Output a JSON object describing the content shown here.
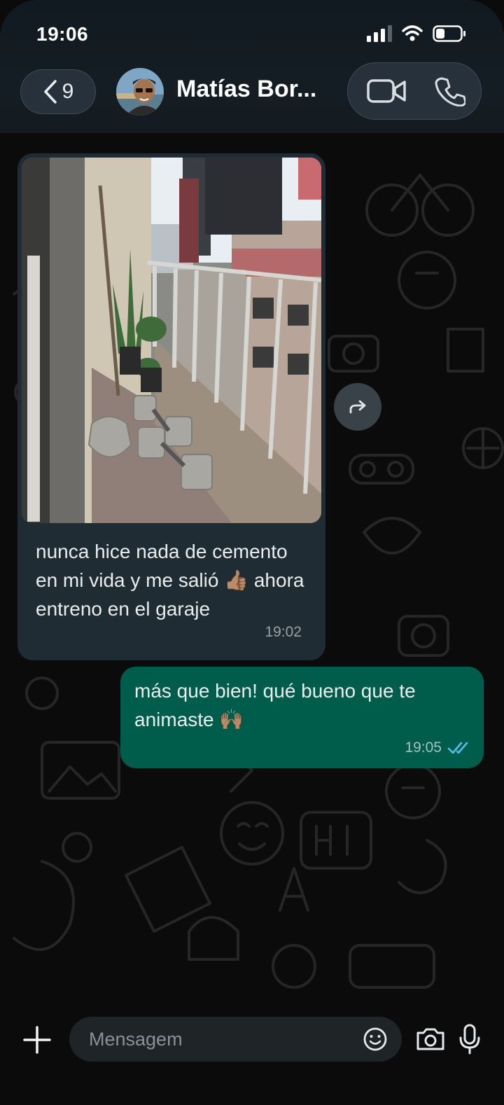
{
  "status_bar": {
    "time": "19:06"
  },
  "header": {
    "back_count": "9",
    "contact_name": "Matías Bor..."
  },
  "messages": [
    {
      "direction": "incoming",
      "has_photo": true,
      "text": "nunca hice nada de cemento en mi vida y me salió 👍🏽  ahora entreno en el garaje",
      "time": "19:02"
    },
    {
      "direction": "outgoing",
      "text": "más que bien! qué bueno que te animaste 🙌🏽",
      "time": "19:05",
      "status": "read"
    }
  ],
  "composer": {
    "placeholder": "Mensagem"
  },
  "colors": {
    "incoming_bubble": "#1f2c34",
    "outgoing_bubble": "#005c4b",
    "read_ticks": "#53bdeb"
  }
}
